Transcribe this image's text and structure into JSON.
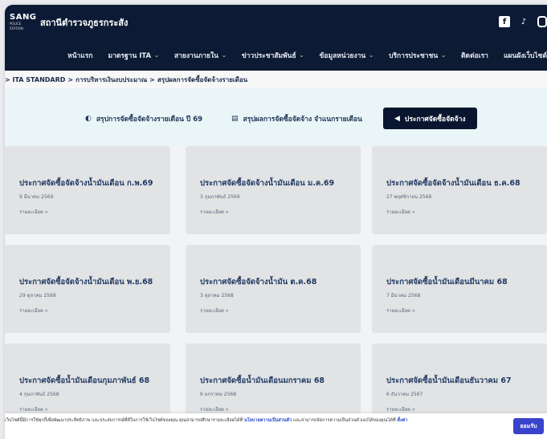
{
  "header": {
    "logo_main": "SANG",
    "logo_sub": "POLICE STATION",
    "station_name": "สถานีตำรวจภูธรกระสัง"
  },
  "socials": [
    {
      "name": "facebook-icon",
      "glyph": "f"
    },
    {
      "name": "tiktok-icon",
      "glyph": "♪"
    },
    {
      "name": "instagram-icon",
      "glyph": "◎"
    }
  ],
  "nav": [
    {
      "label": "หน้าแรก",
      "dropdown": false
    },
    {
      "label": "มาตรฐาน ITA",
      "dropdown": true
    },
    {
      "label": "สายงานภายใน",
      "dropdown": true
    },
    {
      "label": "ข่าวประชาสัมพันธ์",
      "dropdown": true
    },
    {
      "label": "ข้อมูลหน่วยงาน",
      "dropdown": true
    },
    {
      "label": "บริการประชาชน",
      "dropdown": true
    },
    {
      "label": "ติดต่อเรา",
      "dropdown": false
    },
    {
      "label": "แผนผังเว็บไซต์",
      "dropdown": false
    }
  ],
  "breadcrumb": {
    "items": [
      "> ITA STANDARD",
      "การบริหารเงินงบประมาณ",
      "สรุปผลการจัดซื้อจัดจ้างรายเดือน"
    ],
    "separator": ">"
  },
  "tabs": [
    {
      "icon": "◐",
      "label": "สรุปการจัดซื้อจัดจ้างรายเดือน ปี 69",
      "active": false
    },
    {
      "icon": "▤",
      "label": "สรุปผลการจัดซื้อจัดจ้าง จำแนกรายเดือน",
      "active": false
    },
    {
      "icon": "◀",
      "label": "ประกาศจัดซื้อจัดจ้าง",
      "active": true
    }
  ],
  "cards": [
    {
      "title": "ประกาศจัดซื้อจัดจ้างน้ำมันเดือน ก.พ.69",
      "date": "9 มีนาคม 2569",
      "more": "รายละเอียด »"
    },
    {
      "title": "ประกาศจัดซื้อจัดจ้างน้ำมันเดือน ม.ค.69",
      "date": "3 กุมภาพันธ์ 2569",
      "more": "รายละเอียด »"
    },
    {
      "title": "ประกาศจัดซื้อจัดจ้างน้ำมันเดือน ธ.ค.68",
      "date": "27 พฤศจิกายน 2568",
      "more": "รายละเอียด »"
    },
    {
      "title": "ประกาศจัดซื้อจัดจ้างน้ำมันเดือน พ.ย.68",
      "date": "29 ตุลาคม 2568",
      "more": "รายละเอียด »"
    },
    {
      "title": "ประกาศจัดซื้อจัดจ้างน้ำมัน ต.ค.68",
      "date": "3 ตุลาคม 2568",
      "more": "รายละเอียด »"
    },
    {
      "title": "ประกาศจัดซื้อน้ำมันเดือนมีนาคม 68",
      "date": "7 มีนาคม 2568",
      "more": "รายละเอียด »"
    },
    {
      "title": "ประกาศจัดซื้อน้ำมันเดือนกุมภาพันธ์ 68",
      "date": "4 กุมภาพันธ์ 2568",
      "more": "รายละเอียด »"
    },
    {
      "title": "ประกาศจัดซื้อน้ำมันเดือนมกราคม 68",
      "date": "6 มกราคม 2568",
      "more": "รายละเอียด »"
    },
    {
      "title": "ประกาศจัดซื้อน้ำมันเดือนธันวาคม 67",
      "date": "6 ธันวาคม 2567",
      "more": "รายละเอียด »"
    }
  ],
  "cookie": {
    "text_before": "เว็บไซต์นี้มีการใช้คุกกี้เพื่อพัฒนาประสิทธิภาพ และประสบการณ์ที่ดีในการใช้เว็บไซต์ของคุณ คุณสามารถศึกษารายละเอียดได้ที่",
    "policy_link": "นโยบายความเป็นส่วนตัว",
    "text_middle": "และสามารถจัดการความเป็นส่วนตัวเองได้ของคุณได้ที่",
    "settings_link": "ตั้งค่า",
    "accept_label": "ยอมรับ"
  }
}
